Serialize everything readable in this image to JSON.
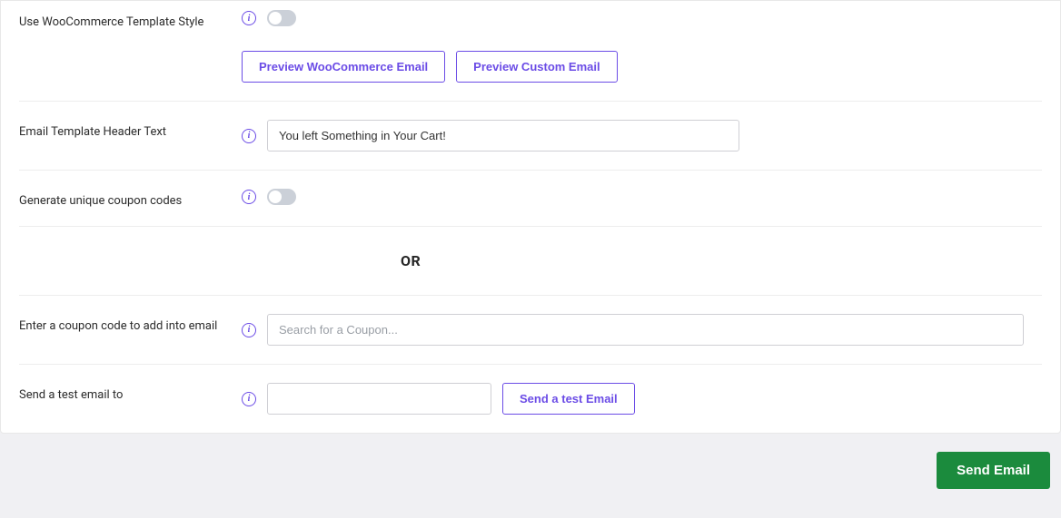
{
  "rows": {
    "woocommerce_style": {
      "label": "Use WooCommerce Template Style",
      "toggle_on": false,
      "preview_wc_label": "Preview WooCommerce Email",
      "preview_custom_label": "Preview Custom Email"
    },
    "header_text": {
      "label": "Email Template Header Text",
      "value": "You left Something in Your Cart!"
    },
    "unique_coupon": {
      "label": "Generate unique coupon codes",
      "toggle_on": false
    },
    "or_text": "OR",
    "coupon_input": {
      "label": "Enter a coupon code to add into email",
      "placeholder": "Search for a Coupon..."
    },
    "test_email": {
      "label": "Send a test email to",
      "value": "",
      "button_label": "Send a test Email"
    }
  },
  "footer": {
    "send_label": "Send Email"
  }
}
